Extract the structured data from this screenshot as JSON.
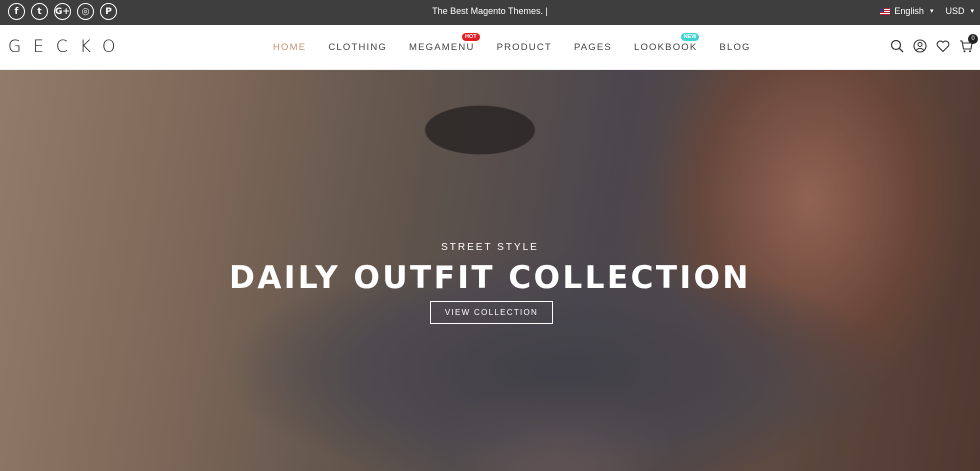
{
  "topbar": {
    "socials": [
      {
        "name": "facebook-icon",
        "glyph": "f"
      },
      {
        "name": "twitter-icon",
        "glyph": "t"
      },
      {
        "name": "google-plus-icon",
        "glyph": "G+"
      },
      {
        "name": "instagram-icon",
        "glyph": "◎"
      },
      {
        "name": "pinterest-icon",
        "glyph": "P"
      }
    ],
    "tagline": "The Best Magento Themes. |",
    "language": "English",
    "currency": "USD"
  },
  "header": {
    "logo": "GECKO",
    "nav": [
      {
        "label": "HOME",
        "active": true
      },
      {
        "label": "CLOTHING"
      },
      {
        "label": "MEGAMENU",
        "badge": "HOT"
      },
      {
        "label": "PRODUCT"
      },
      {
        "label": "PAGES"
      },
      {
        "label": "LOOKBOOK",
        "badge": "NEW"
      },
      {
        "label": "BLOG"
      }
    ],
    "cart_count": "0",
    "icons": [
      "search-icon",
      "user-icon",
      "heart-icon",
      "cart-icon"
    ]
  },
  "hero": {
    "subtitle": "STREET STYLE",
    "title": "DAILY OUTFIT COLLECTION",
    "cta": "VIEW COLLECTION"
  },
  "colors": {
    "topbar_bg": "#3e3e3e",
    "nav_active": "#c2956f",
    "badge_hot": "#e31e24",
    "badge_new": "#3fd3d1"
  }
}
